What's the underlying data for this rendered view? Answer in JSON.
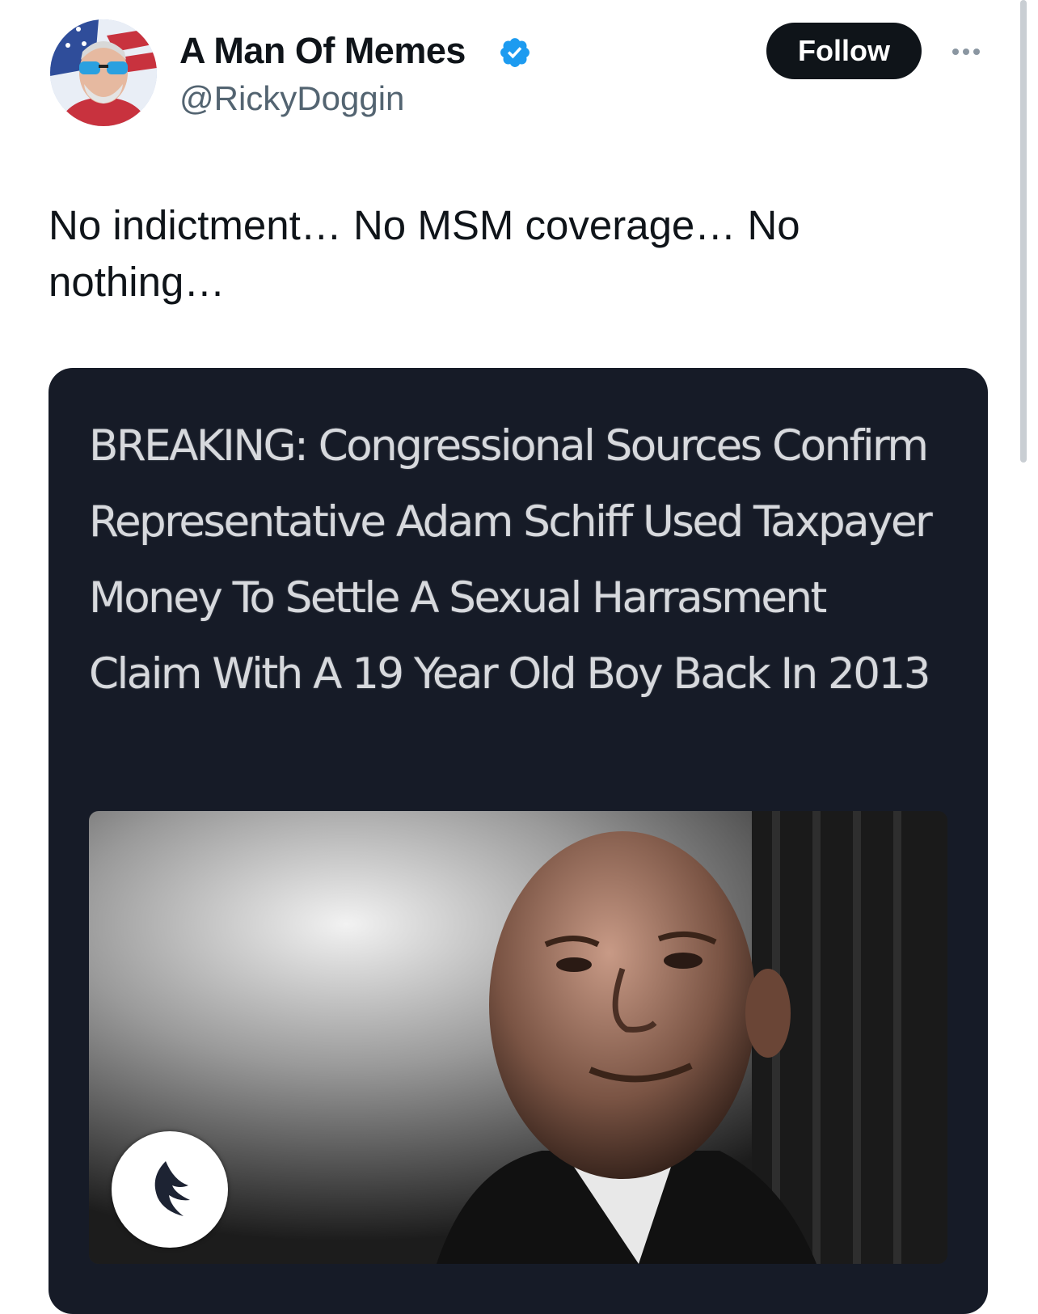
{
  "user": {
    "display_name": "A Man Of Memes",
    "handle": "@RickyDoggin",
    "verified": true,
    "verified_color": "#1d9bf0"
  },
  "actions": {
    "follow_label": "Follow",
    "more_icon": "more-horizontal-icon"
  },
  "tweet": {
    "text": "No indictment… No MSM coverage… No nothing…"
  },
  "media": {
    "headline": "BREAKING: Congressional Sources Confirm Representative Adam Schiff Used Taxpayer Money To Settle A Sexual Harrasment Claim With A 19 Year Old Boy Back In 2013",
    "background_color": "#161b27",
    "logo_icon": "bird-wing-logo-icon"
  }
}
